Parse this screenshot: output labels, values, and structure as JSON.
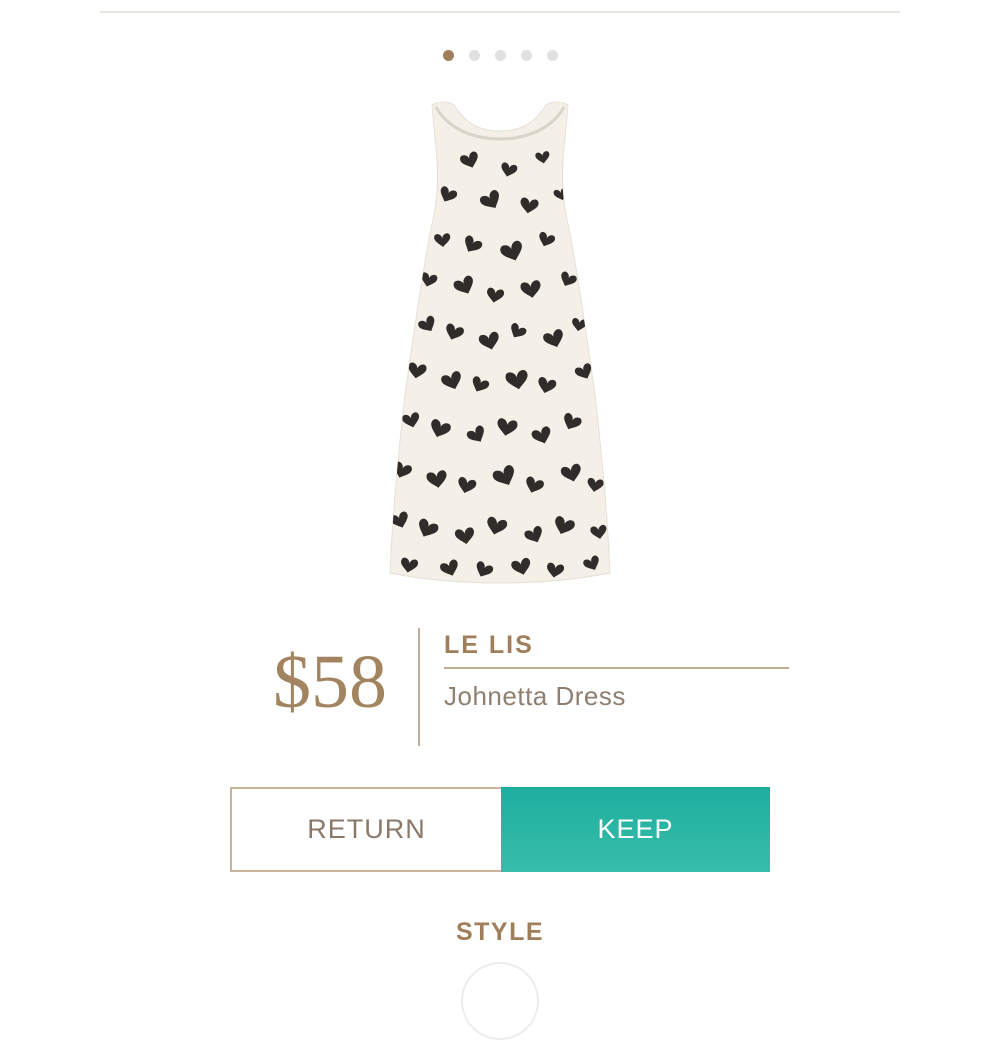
{
  "pager": {
    "total": 5,
    "active_index": 0
  },
  "product": {
    "price": "$58",
    "brand": "LE LIS",
    "name": "Johnetta Dress",
    "image_icon": "dress-product-image"
  },
  "actions": {
    "return_label": "RETURN",
    "keep_label": "KEEP"
  },
  "section": {
    "title": "STYLE"
  },
  "colors": {
    "accent": "#a07e5a",
    "keep": "#22b09f",
    "divider": "#c4ad94"
  }
}
